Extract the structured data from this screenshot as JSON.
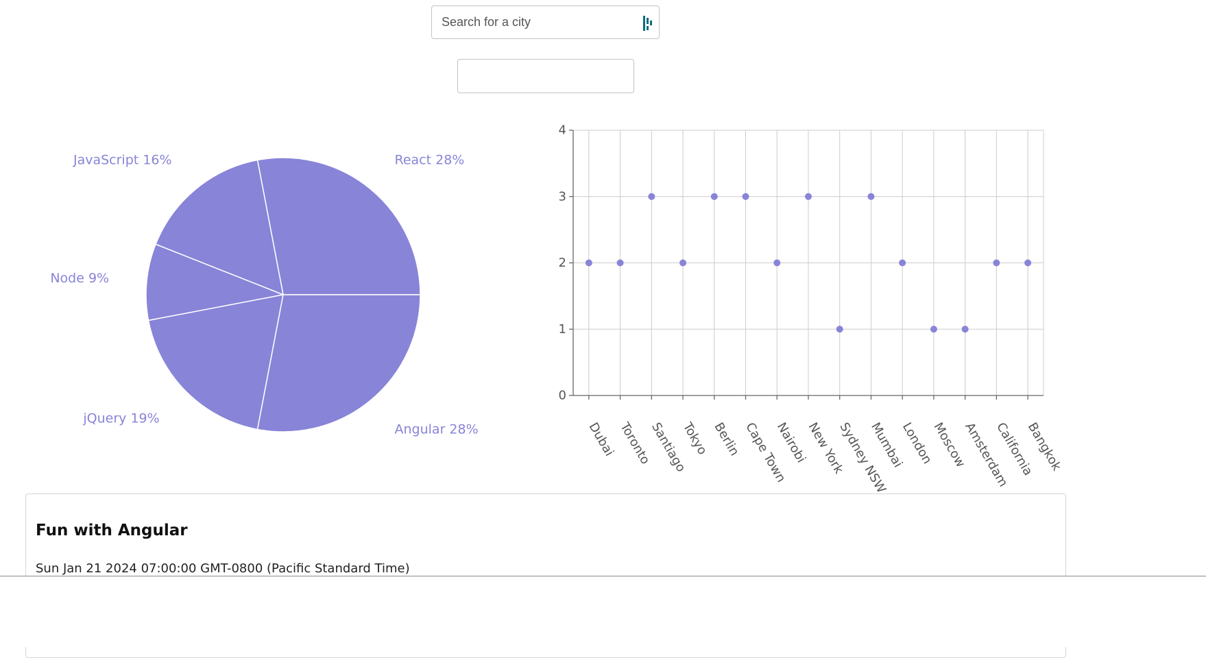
{
  "search": {
    "placeholder": "Search for a city",
    "value": ""
  },
  "second_input": {
    "value": ""
  },
  "colors": {
    "accent": "#8884d8",
    "grid": "#cccccc",
    "axis": "#666666",
    "tick_text": "#555555"
  },
  "chart_data": [
    {
      "type": "pie",
      "labels": [
        "React",
        "JavaScript",
        "Node",
        "jQuery",
        "Angular"
      ],
      "values": [
        28,
        16,
        9,
        19,
        28
      ],
      "label_text": [
        "React 28%",
        "JavaScript 16%",
        "Node 9%",
        "jQuery 19%",
        "Angular 28%"
      ]
    },
    {
      "type": "scatter",
      "categories": [
        "Dubai",
        "Toronto",
        "Santiago",
        "Tokyo",
        "Berlin",
        "Cape Town",
        "Nairobi",
        "New York",
        "Sydney NSW",
        "Mumbai",
        "London",
        "Moscow",
        "Amsterdam",
        "California",
        "Bangkok"
      ],
      "values": [
        2,
        2,
        3,
        2,
        3,
        3,
        2,
        3,
        1,
        3,
        2,
        1,
        1,
        2,
        2
      ],
      "ylim": [
        0,
        4
      ],
      "yticks": [
        "0",
        "1",
        "2",
        "3",
        "4"
      ],
      "grid": true
    }
  ],
  "card": {
    "title": "Fun with Angular",
    "date": "Sun Jan 21 2024 07:00:00 GMT-0800 (Pacific Standard Time)"
  }
}
